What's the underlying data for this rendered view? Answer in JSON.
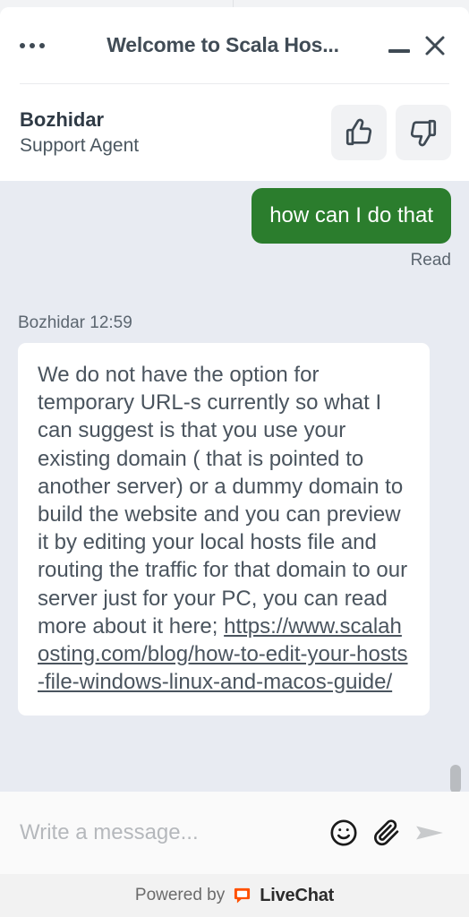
{
  "header": {
    "menu_icon": "more-horizontal-icon",
    "title": "Welcome to Scala Hos...",
    "minimize_icon": "minimize-icon",
    "close_icon": "close-icon"
  },
  "agent": {
    "name": "Bozhidar",
    "role": "Support Agent",
    "thumbs_up_icon": "thumbs-up-icon",
    "thumbs_down_icon": "thumbs-down-icon"
  },
  "chat": {
    "outgoing_message": {
      "text": "how can I do that",
      "status": "Read",
      "bubble_color": "#2B7D2D"
    },
    "incoming_message": {
      "meta": "Bozhidar 12:59",
      "author": "Bozhidar",
      "time": "12:59",
      "text_before_link": "We do not have the option for temporary URL-s currently so what I can suggest is that you use your existing domain ( that is pointed to another server) or a dummy domain to build the website and you can preview it by editing your local hosts file and routing the traffic for that domain to our server just for your PC, you can read more about it here; ",
      "link_text": "https://www.scalahosting.com/blog/how-to-edit-your-hosts-file-windows-linux-and-macos-guide/"
    },
    "scrollbar_icon": "scrollbar-thumb"
  },
  "composer": {
    "placeholder": "Write a message...",
    "value": "",
    "emoji_icon": "emoji-icon",
    "attachment_icon": "paperclip-icon",
    "send_icon": "send-icon"
  },
  "footer": {
    "powered_by": "Powered by",
    "brand": "LiveChat",
    "brand_icon": "livechat-logo-icon",
    "brand_color": "#FF5100"
  }
}
